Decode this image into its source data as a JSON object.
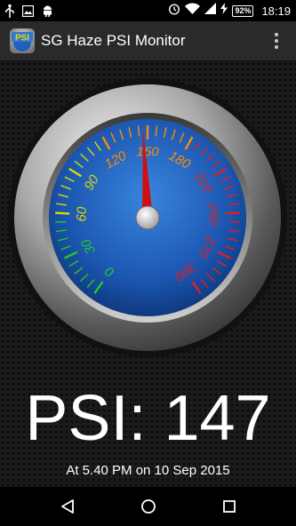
{
  "status_bar": {
    "battery": "92%",
    "time": "18:19",
    "icons": [
      "usb-icon",
      "image-icon",
      "android-icon",
      "alarm-icon",
      "wifi-icon",
      "signal-icon",
      "battery-charging-icon"
    ]
  },
  "app_bar": {
    "title": "SG Haze PSI Monitor",
    "logo_text": "PSI",
    "overflow_icon": "more-vertical-icon"
  },
  "gauge": {
    "min": 0,
    "max": 300,
    "value": 147,
    "tick_labels": [
      "0",
      "30",
      "60",
      "90",
      "120",
      "150",
      "180",
      "210",
      "240",
      "270",
      "300"
    ],
    "label_colors": [
      "#22cc22",
      "#22cc22",
      "#d9d900",
      "#d9d900",
      "#ff8c00",
      "#ff8c00",
      "#ff8c00",
      "#e02020",
      "#e02020",
      "#e02020",
      "#e02020"
    ],
    "needle_color": "#d01010",
    "dial_color": "#1f5fbf"
  },
  "reading": {
    "psi_text": "PSI: 147",
    "timestamp": "At 5.40 PM on 10 Sep 2015"
  },
  "nav_bar": {
    "back_icon": "back-icon",
    "home_icon": "home-icon",
    "recents_icon": "recents-icon"
  }
}
